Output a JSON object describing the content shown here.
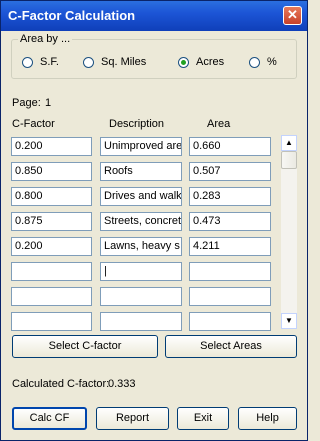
{
  "window": {
    "title": "C-Factor Calculation",
    "close_glyph": "✕"
  },
  "area_by": {
    "legend": "Area by ...",
    "options": [
      {
        "label": "S.F.",
        "selected": false
      },
      {
        "label": "Sq. Miles",
        "selected": false
      },
      {
        "label": "Acres",
        "selected": true
      },
      {
        "label": "%",
        "selected": false
      }
    ]
  },
  "page": {
    "label": "Page:",
    "number": "1"
  },
  "table": {
    "headers": [
      "C-Factor",
      "Description",
      "Area"
    ],
    "rows": [
      {
        "cfactor": "0.200",
        "description": "Unimproved are",
        "area": "0.660"
      },
      {
        "cfactor": "0.850",
        "description": "Roofs",
        "area": "0.507"
      },
      {
        "cfactor": "0.800",
        "description": "Drives and walk",
        "area": "0.283"
      },
      {
        "cfactor": "0.875",
        "description": "Streets, concret",
        "area": "0.473"
      },
      {
        "cfactor": "0.200",
        "description": "Lawns, heavy s",
        "area": "4.211"
      },
      {
        "cfactor": "",
        "description": "|",
        "area": ""
      },
      {
        "cfactor": "",
        "description": "",
        "area": ""
      },
      {
        "cfactor": "",
        "description": "",
        "area": ""
      }
    ]
  },
  "scrollbar": {
    "up_glyph": "▲",
    "down_glyph": "▼"
  },
  "buttons": {
    "select_cfactor": "Select C-factor",
    "select_areas": "Select Areas",
    "calc_cf": "Calc CF",
    "report": "Report",
    "exit": "Exit",
    "help": "Help"
  },
  "result": {
    "label": "Calculated C-factor:",
    "value": "0.333"
  }
}
